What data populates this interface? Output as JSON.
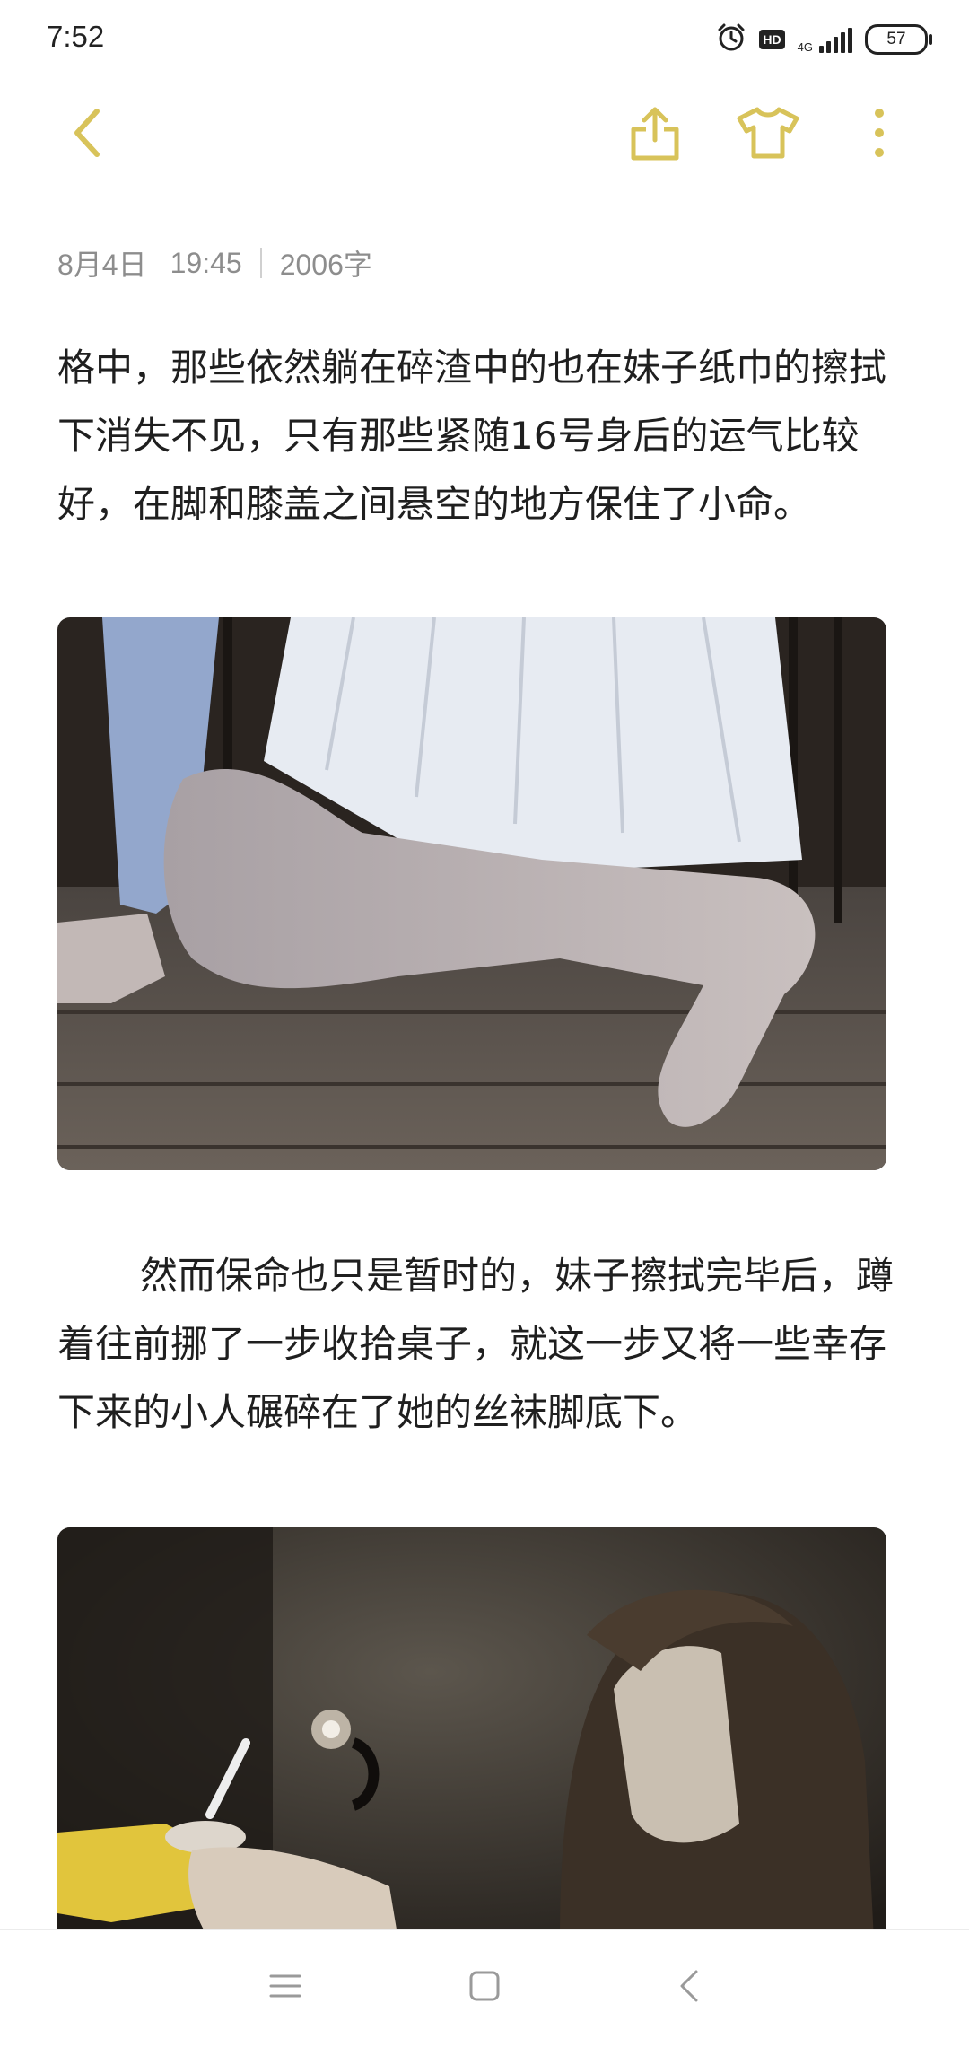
{
  "status_bar": {
    "time": "7:52",
    "hd": "HD",
    "network": "4G",
    "battery": "57",
    "icons": [
      "alarm-icon",
      "hd-icon",
      "signal-icon",
      "battery-icon"
    ]
  },
  "toolbar": {
    "icons": [
      "back-chevron-icon",
      "share-icon",
      "theme-shirt-icon",
      "more-vertical-icon"
    ],
    "accent_color": "#d8c35a"
  },
  "note": {
    "date": "8月4日",
    "time": "19:45",
    "word_count": "2006字",
    "paragraph_1": "格中，那些依然躺在碎渣中的也在妹子纸巾的擦拭下消失不见，只有那些紧随16号身后的运气比较好，在脚和膝盖之间悬空的地方保住了小命。",
    "paragraph_2": "然而保命也只是暂时的，妹子擦拭完毕后，蹲着往前挪了一步收拾桌子，就这一步又将一些幸存下来的小人碾碎在了她的丝袜脚底下。"
  },
  "nav_bar": {
    "icons": [
      "menu-icon",
      "home-square-icon",
      "back-icon"
    ]
  }
}
